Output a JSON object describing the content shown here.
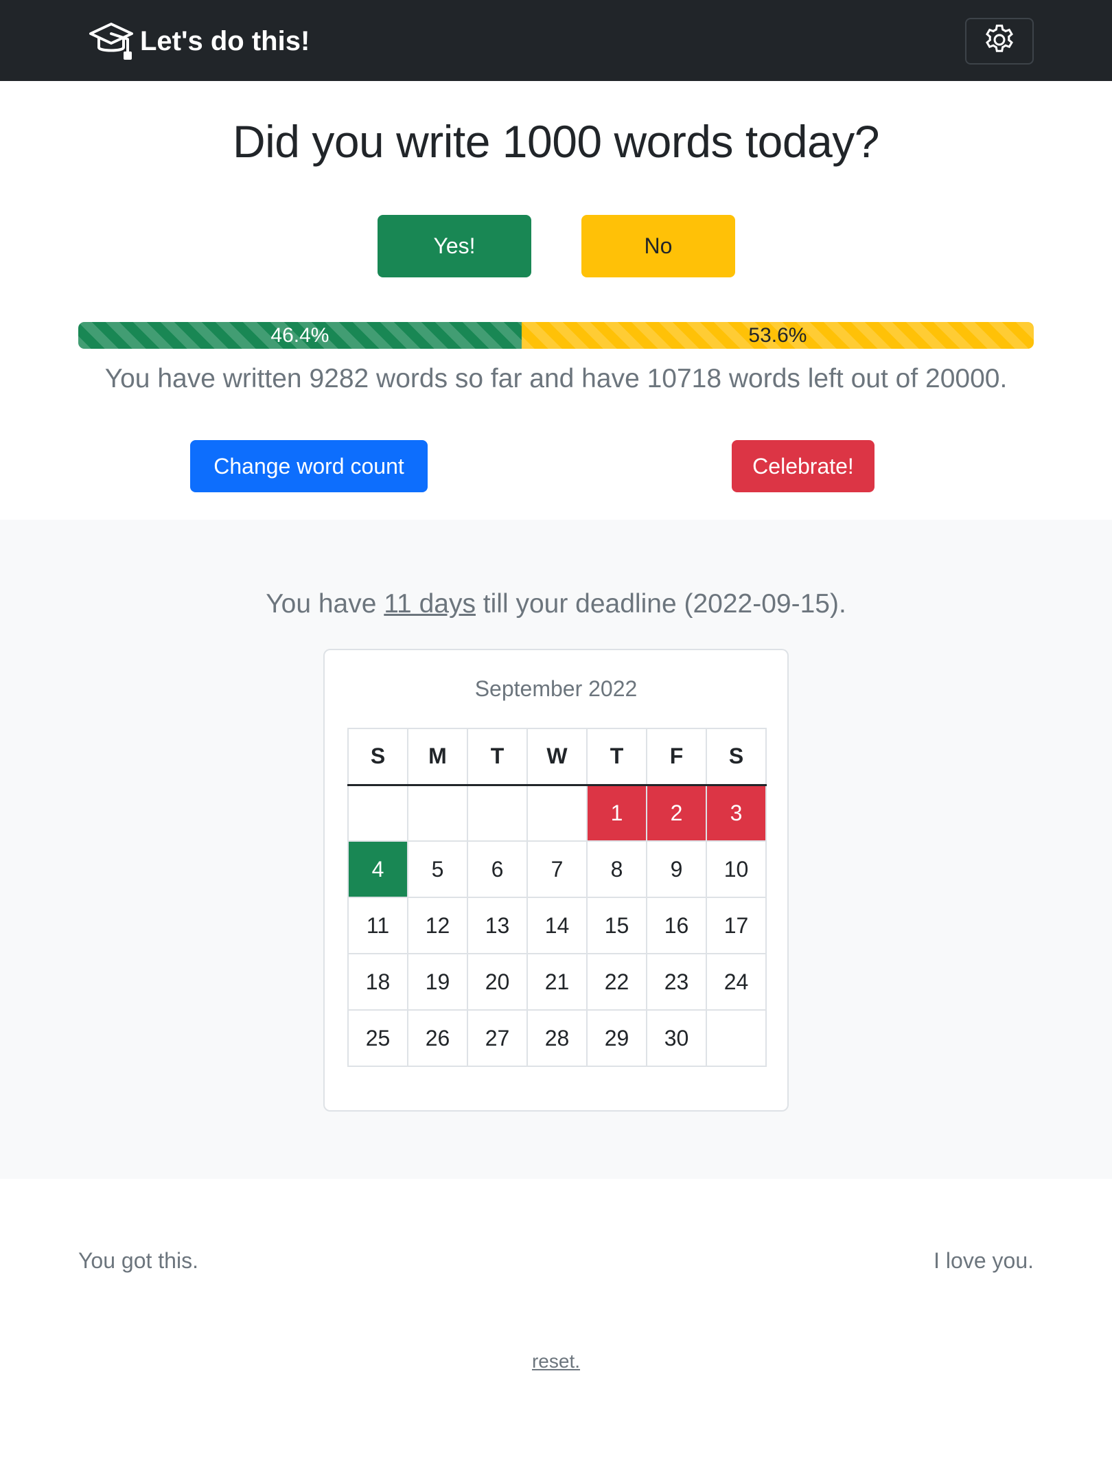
{
  "navbar": {
    "brand_icon": "graduation-cap-icon",
    "brand_text": "Let's do this!",
    "settings_icon": "gear-icon",
    "background": "#212529"
  },
  "main": {
    "question": "Did you write 1000 words today?",
    "yes_label": "Yes!",
    "no_label": "No",
    "progress": {
      "written_fraction": 0.464,
      "written_label": "46.4%",
      "left_fraction": 0.536,
      "left_label": "53.6%"
    },
    "summary": "You have written 9282 words so far and have 10718 words left out of 20000.",
    "change_label": "Change word count",
    "celebrate_label": "Celebrate!"
  },
  "deadline": {
    "prefix": "You have ",
    "days": "11 days",
    "suffix": " till your deadline (2022-09-15)."
  },
  "calendar": {
    "month": "September 2022",
    "weekdays": [
      "S",
      "M",
      "T",
      "W",
      "T",
      "F",
      "S"
    ],
    "weeks": [
      [
        "",
        "",
        "",
        "",
        "1",
        "2",
        "3"
      ],
      [
        "4",
        "5",
        "6",
        "7",
        "8",
        "9",
        "10"
      ],
      [
        "11",
        "12",
        "13",
        "14",
        "15",
        "16",
        "17"
      ],
      [
        "18",
        "19",
        "20",
        "21",
        "22",
        "23",
        "24"
      ],
      [
        "25",
        "26",
        "27",
        "28",
        "29",
        "30",
        ""
      ]
    ],
    "missed_days": [
      "1",
      "2",
      "3"
    ],
    "done_days": [
      "4"
    ]
  },
  "footer": {
    "left": "You got this.",
    "right": "I love you.",
    "reset": "reset."
  },
  "colors": {
    "success": "#198754",
    "warning": "#ffc107",
    "primary": "#0d6efd",
    "danger": "#dc3545"
  }
}
